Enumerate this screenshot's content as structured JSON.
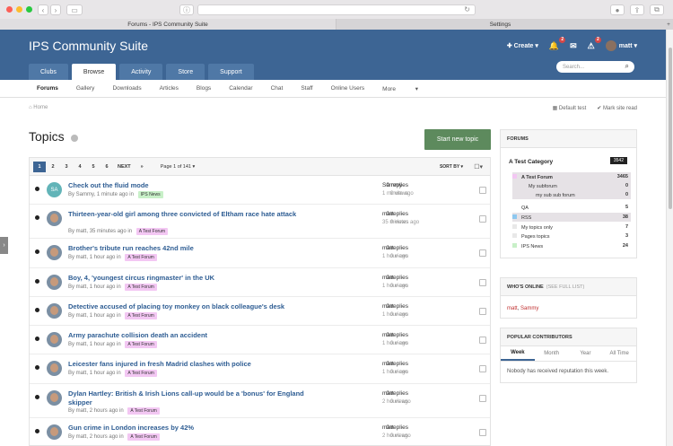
{
  "browser": {
    "tabs": [
      "Forums - IPS Community Suite",
      "Settings"
    ],
    "new_tab": "+"
  },
  "header": {
    "site_title": "IPS Community Suite",
    "create_label": "Create",
    "notifications_count": "2",
    "reports_count": "2",
    "user_name": "matt",
    "search_placeholder": "Search...",
    "nav_tabs": [
      {
        "label": "Clubs"
      },
      {
        "label": "Browse"
      },
      {
        "label": "Activity"
      },
      {
        "label": "Store"
      },
      {
        "label": "Support"
      }
    ]
  },
  "subnav": [
    "Forums",
    "Gallery",
    "Downloads",
    "Articles",
    "Blogs",
    "Calendar",
    "Chat",
    "Staff",
    "Online Users",
    "More"
  ],
  "breadcrumb": {
    "home": "Home"
  },
  "actions": {
    "default_test": "Default test",
    "mark_read": "Mark site read"
  },
  "page": {
    "title": "Topics",
    "start_button": "Start new topic"
  },
  "pager": {
    "pages": [
      "1",
      "2",
      "3",
      "4",
      "5",
      "6"
    ],
    "next": "NEXT",
    "last": "»",
    "page_of": "Page 1 of 141",
    "sort_by": "SORT BY"
  },
  "topics": [
    {
      "title": "Check out the fluid mode",
      "author": "Sammy",
      "time": "1 minute ago",
      "forum": "IPS News",
      "replies": "0 replies",
      "views": "0 views",
      "last_user": "Sammy",
      "last_time": "1 minute ago",
      "avatar_initials": "SA"
    },
    {
      "title": "Thirteen-year-old girl among three convicted of Eltham race hate attack",
      "author": "matt",
      "time": "35 minutes ago",
      "forum": "A Test Forum",
      "replies": "0 replies",
      "views": "0 views",
      "last_user": "matt",
      "last_time": "35 minutes ago"
    },
    {
      "title": "Brother's tribute run reaches 42nd mile",
      "author": "matt",
      "time": "1 hour ago",
      "forum": "A Test Forum",
      "replies": "0 replies",
      "views": "0 views",
      "last_user": "matt",
      "last_time": "1 hour ago"
    },
    {
      "title": "Boy, 4, 'youngest circus ringmaster' in the UK",
      "author": "matt",
      "time": "1 hour ago",
      "forum": "A Test Forum",
      "replies": "0 replies",
      "views": "0 views",
      "last_user": "matt",
      "last_time": "1 hour ago"
    },
    {
      "title": "Detective accused of placing toy monkey on black colleague's desk",
      "author": "matt",
      "time": "1 hour ago",
      "forum": "A Test Forum",
      "replies": "0 replies",
      "views": "0 views",
      "last_user": "matt",
      "last_time": "1 hour ago"
    },
    {
      "title": "Army parachute collision death an accident",
      "author": "matt",
      "time": "1 hour ago",
      "forum": "A Test Forum",
      "replies": "0 replies",
      "views": "0 views",
      "last_user": "matt",
      "last_time": "1 hour ago"
    },
    {
      "title": "Leicester fans injured in fresh Madrid clashes with police",
      "author": "matt",
      "time": "1 hour ago",
      "forum": "A Test Forum",
      "replies": "0 replies",
      "views": "0 views",
      "last_user": "matt",
      "last_time": "1 hour ago"
    },
    {
      "title": "Dylan Hartley: British & Irish Lions call-up would be a 'bonus' for England skipper",
      "author": "matt",
      "time": "2 hours ago",
      "forum": "A Test Forum",
      "replies": "0 replies",
      "views": "0 views",
      "last_user": "matt",
      "last_time": "2 hours ago"
    },
    {
      "title": "Gun crime in London increases by 42%",
      "author": "matt",
      "time": "2 hours ago",
      "forum": "A Test Forum",
      "replies": "0 replies",
      "views": "0 views",
      "last_user": "matt",
      "last_time": "2 hours ago"
    }
  ],
  "sidebar": {
    "forums_heading": "FORUMS",
    "category": {
      "title": "A Test Category",
      "count": "3542"
    },
    "forums": [
      {
        "name": "A Test Forum",
        "count": "3465",
        "color": "#f3c7f3"
      },
      {
        "name": "My subforum",
        "count": "0",
        "color": ""
      },
      {
        "name": "my sub sub forum",
        "count": "0",
        "color": ""
      },
      {
        "name": "QA",
        "count": "5",
        "color": "#ffffff"
      },
      {
        "name": "RSS",
        "count": "38",
        "color": "#8ec8ef"
      },
      {
        "name": "My topics only",
        "count": "7",
        "color": "#e8e8e8"
      },
      {
        "name": "Pages topics",
        "count": "3",
        "color": "#e8e8e8"
      },
      {
        "name": "IPS News",
        "count": "24",
        "color": "#c8f0c8"
      }
    ],
    "who_heading": "WHO'S ONLINE",
    "who_full": "(SEE FULL LIST)",
    "who_names": [
      "matt",
      "Sammy"
    ],
    "pc_heading": "POPULAR CONTRIBUTORS",
    "pc_tabs": [
      "Week",
      "Month",
      "Year",
      "All Time"
    ],
    "pc_empty": "Nobody has received reputation this week."
  },
  "colors": {
    "header": "#3d6594",
    "start_button": "#5d8a5d",
    "link": "#2e5d93"
  }
}
